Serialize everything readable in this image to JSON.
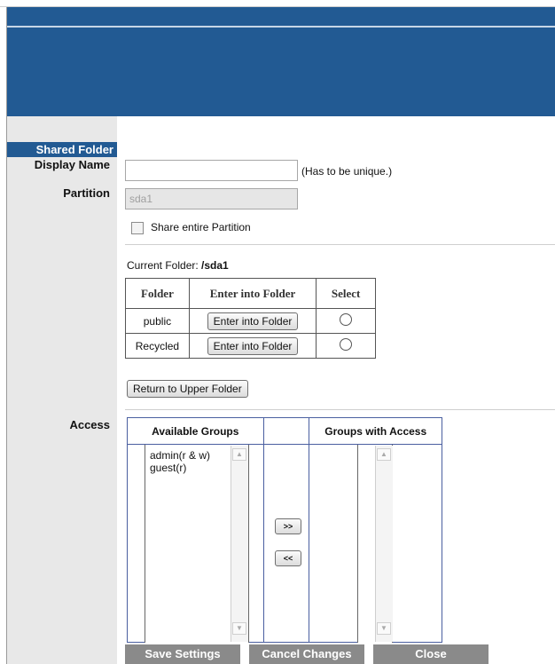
{
  "page": {
    "section_title": "Shared Folder",
    "labels": {
      "display_name": "Display Name",
      "partition": "Partition",
      "access": "Access"
    },
    "display_name": {
      "value": "",
      "hint": "(Has to be unique.)"
    },
    "partition": {
      "value": "sda1",
      "share_entire_label": "Share entire Partition",
      "share_entire_checked": false
    },
    "current_folder": {
      "label": "Current Folder:",
      "path": "/sda1"
    },
    "folders_table": {
      "headers": [
        "Folder",
        "Enter into Folder",
        "Select"
      ],
      "rows": [
        {
          "folder": "public",
          "button": "Enter into Folder"
        },
        {
          "folder": "Recycled",
          "button": "Enter into Folder"
        }
      ]
    },
    "return_button": "Return to Upper Folder",
    "access": {
      "available_header": "Available Groups",
      "with_access_header": "Groups with Access",
      "available_groups": [
        "admin(r & w)",
        "guest(r)"
      ],
      "groups_with_access": [],
      "add_button": ">>",
      "remove_button": "<<"
    },
    "buttons": {
      "save": "Save Settings",
      "cancel": "Cancel Changes",
      "close": "Close"
    }
  },
  "colors": {
    "banner": "#225a93",
    "sidebar": "#e8e8e8",
    "bottom_button": "#8a8a8a"
  }
}
